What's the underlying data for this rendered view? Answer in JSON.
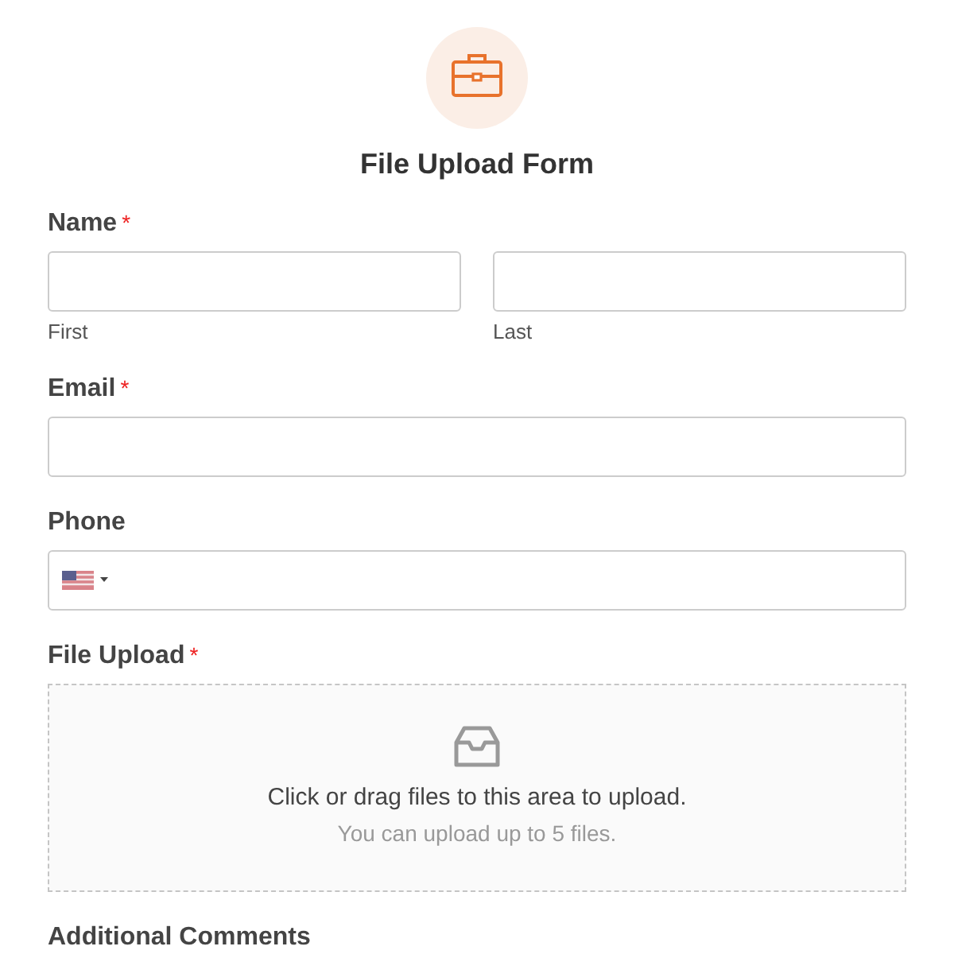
{
  "header": {
    "title": "File Upload Form"
  },
  "fields": [
    {
      "kind": "name",
      "label": "Name",
      "required_mark": "*",
      "sublabels": [
        "First",
        "Last"
      ]
    },
    {
      "kind": "text",
      "label": "Email",
      "required_mark": "*"
    },
    {
      "kind": "phone",
      "label": "Phone"
    },
    {
      "kind": "upload",
      "label": "File Upload",
      "required_mark": "*",
      "prompt": "Click or drag files to this area to upload.",
      "hint": "You can upload up to 5 files."
    },
    {
      "kind": "label",
      "label": "Additional Comments"
    }
  ]
}
